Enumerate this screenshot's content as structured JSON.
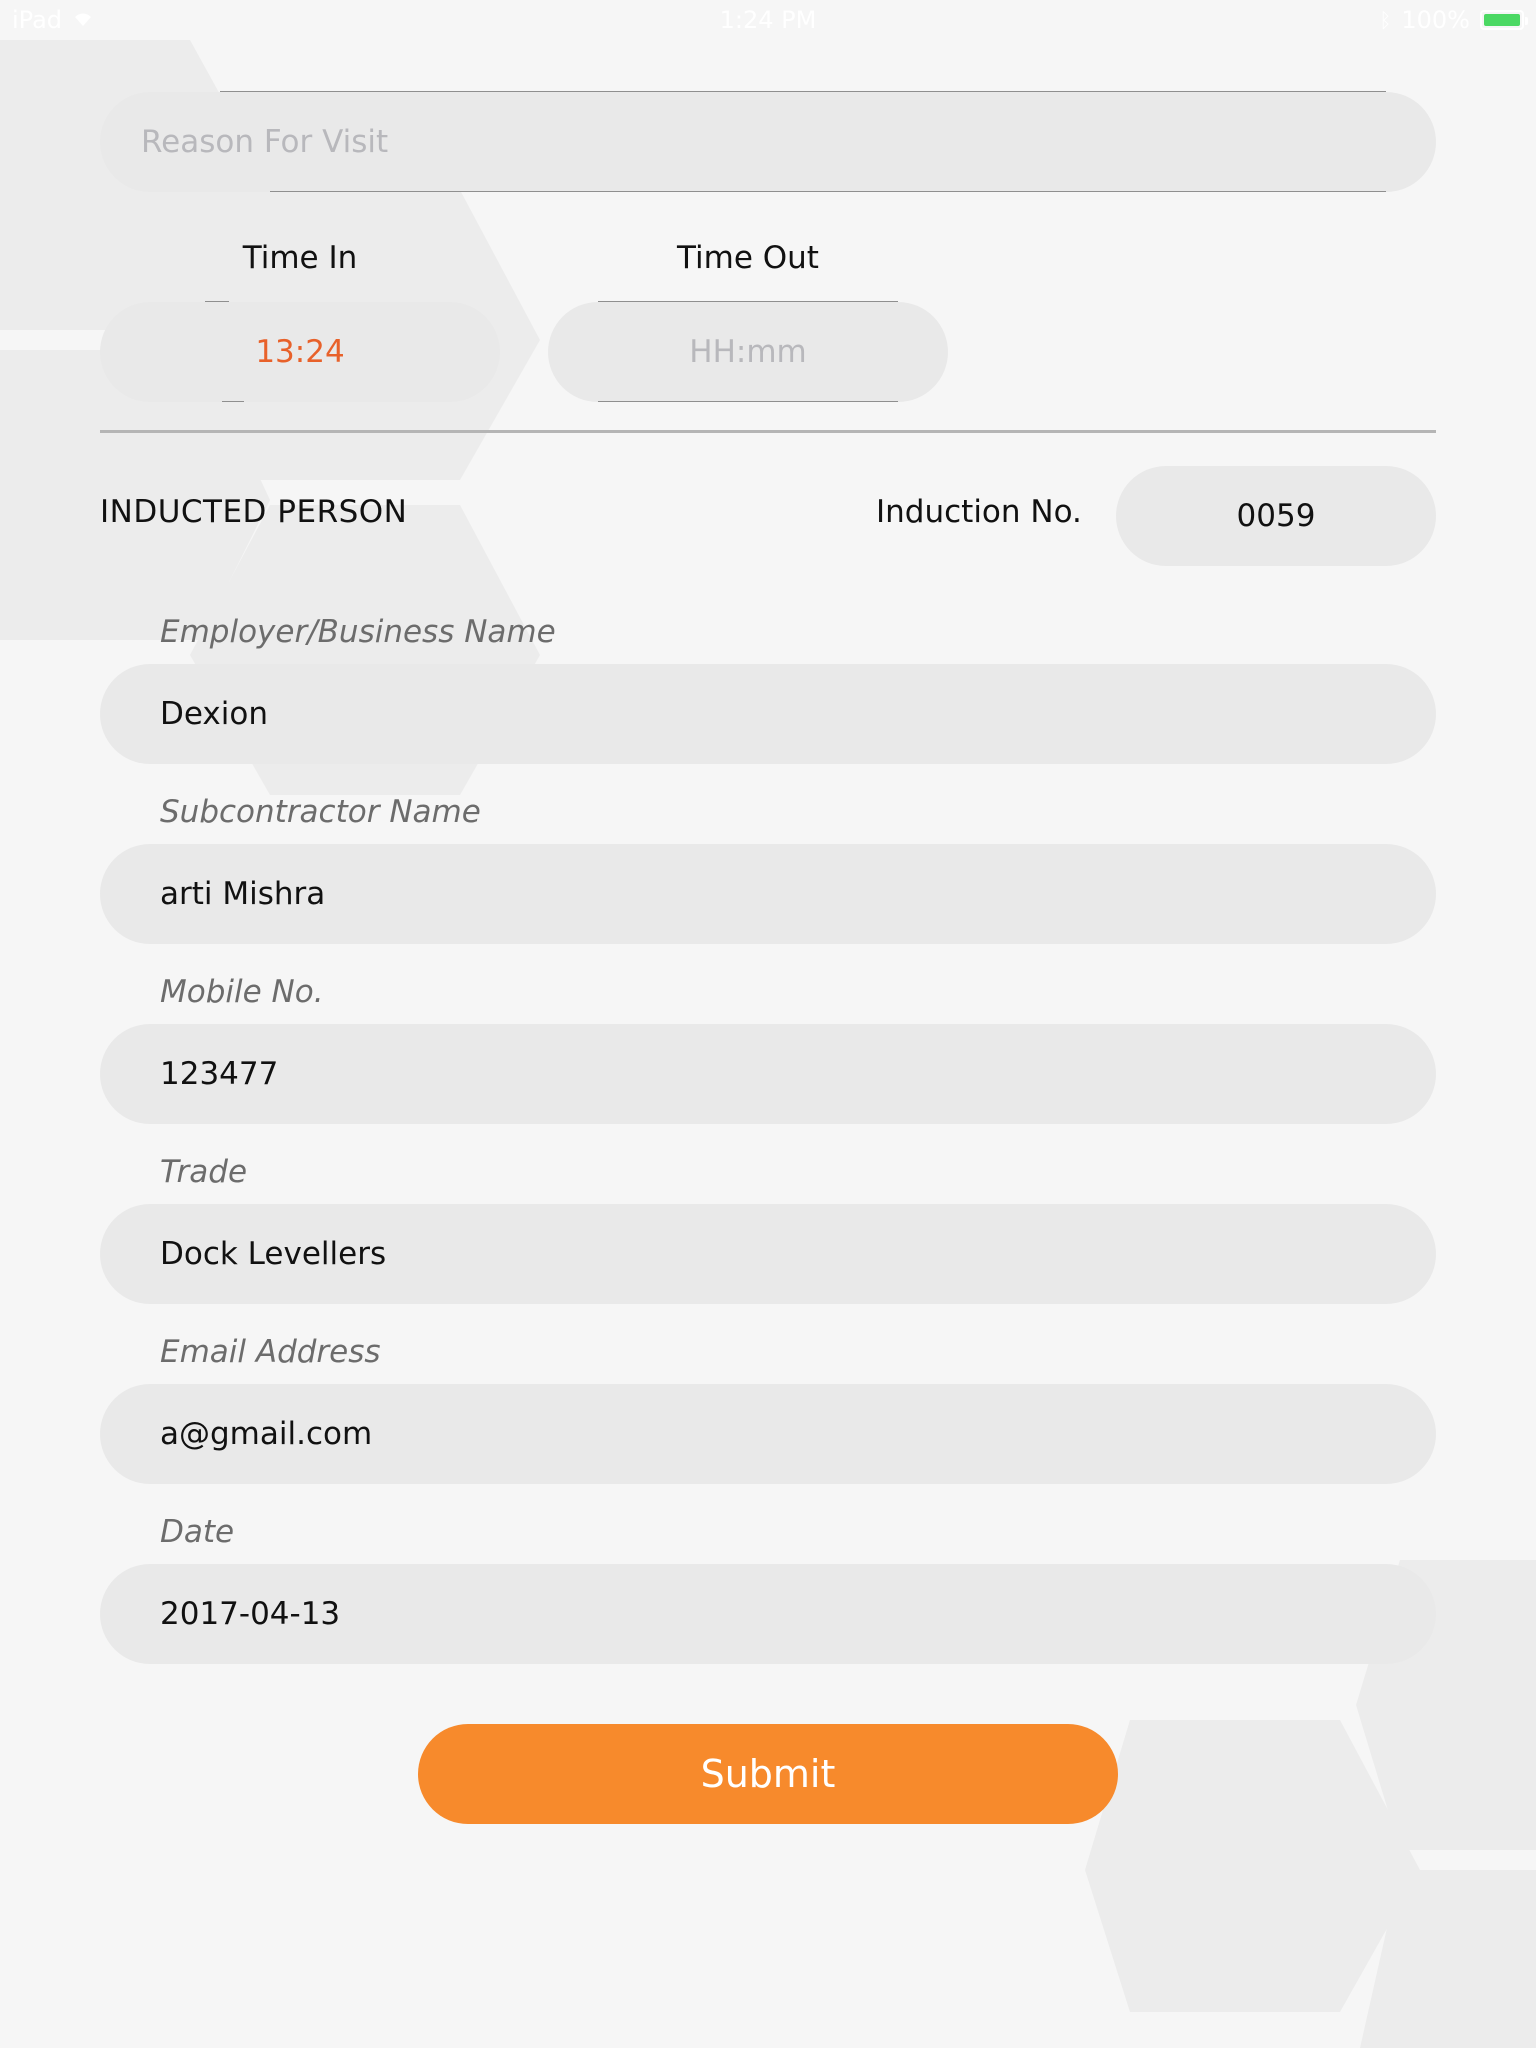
{
  "status_bar": {
    "device": "iPad",
    "time": "1:24 PM",
    "battery_text": "100%",
    "battery_level": 1.0
  },
  "visit": {
    "reason_placeholder": "Reason For Visit",
    "time_in_label": "Time In",
    "time_out_label": "Time Out",
    "time_in_value": "13:24",
    "time_out_placeholder": "HH:mm"
  },
  "inducted_person": {
    "section_title": "INDUCTED PERSON",
    "induction_label": "Induction No.",
    "induction_number": "0059",
    "fields": [
      {
        "label": "Employer/Business Name",
        "value": "Dexion"
      },
      {
        "label": "Subcontractor Name",
        "value": "arti Mishra"
      },
      {
        "label": "Mobile No.",
        "value": "123477"
      },
      {
        "label": "Trade",
        "value": "Dock Levellers"
      },
      {
        "label": "Email Address",
        "value": "a@gmail.com"
      },
      {
        "label": "Date",
        "value": "2017-04-13"
      }
    ]
  },
  "submit_label": "Submit",
  "colors": {
    "accent_orange": "#f78a2c",
    "time_in_text": "#e8612a",
    "field_background": "#e9e9e9",
    "page_background": "#f6f6f6",
    "battery_green": "#4cd964"
  }
}
